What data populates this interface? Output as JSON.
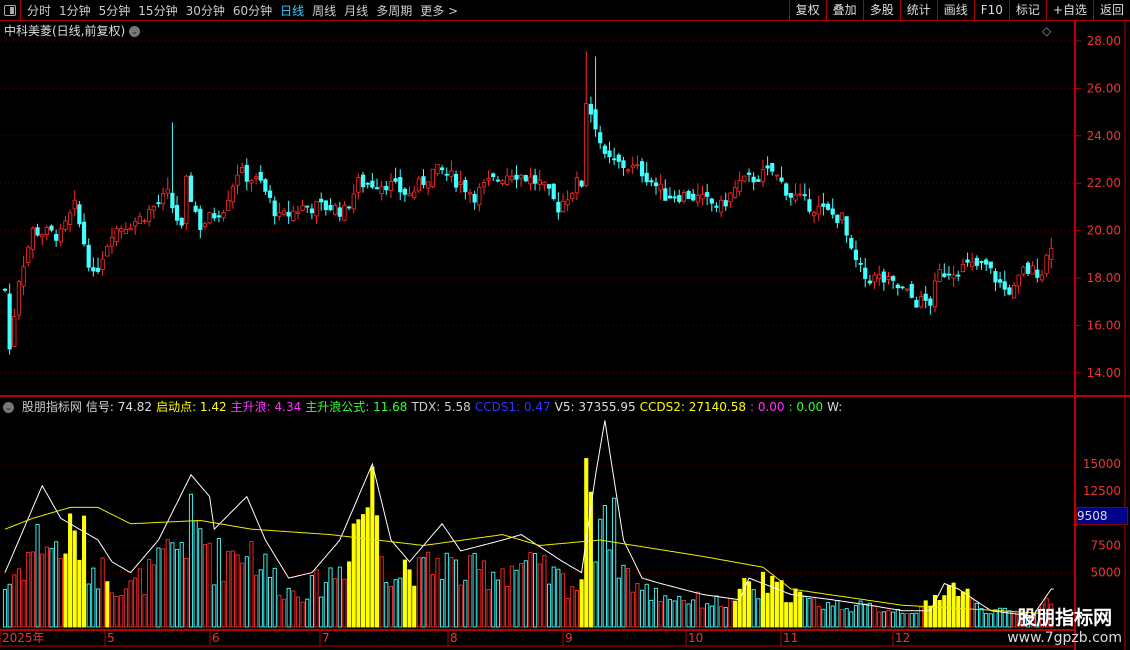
{
  "toolbar": {
    "tabs": [
      "分时",
      "1分钟",
      "5分钟",
      "15分钟",
      "30分钟",
      "60分钟",
      "日线",
      "周线",
      "月线",
      "多周期",
      "更多 >"
    ],
    "active": "日线",
    "right_buttons": [
      "复权",
      "叠加",
      "多股",
      "统计",
      "画线",
      "F10",
      "标记",
      "+自选",
      "返回"
    ]
  },
  "stock_title": "中科美菱(日线,前复权)",
  "indicator": {
    "name": "股朋指标网",
    "items": [
      {
        "label": "信号: 74.82",
        "color": "#dddddd"
      },
      {
        "label": "启动点: 1.42",
        "color": "#ffff00"
      },
      {
        "label": "主升浪: 4.34",
        "color": "#ff33ff"
      },
      {
        "label": "主升浪公式: 11.68",
        "color": "#33ff33"
      },
      {
        "label": "TDX: 5.58",
        "color": "#cccccc"
      },
      {
        "label": "CCDS1: 0.47",
        "color": "#3333ff"
      },
      {
        "label": "V5: 37355.95",
        "color": "#dddddd"
      },
      {
        "label": "CCDS2: 27140.58",
        "color": "#ffff00"
      },
      {
        "label": ": 0.00",
        "color": "#ff33ff"
      },
      {
        "label": ": 0.00",
        "color": "#33ff33"
      },
      {
        "label": "W:",
        "color": "#dddddd"
      }
    ]
  },
  "price_axis": [
    "28.00",
    "26.00",
    "24.00",
    "22.00",
    "20.00",
    "18.00",
    "16.00",
    "14.00"
  ],
  "vol_axis": [
    "15000",
    "12500",
    "7500",
    "5000"
  ],
  "vol_marker": "9508",
  "months": [
    "2025年",
    "5",
    "6",
    "7",
    "8",
    "9",
    "10",
    "11",
    "12"
  ],
  "watermark": {
    "name": "股朋指标网",
    "url": "www.7gpzb.com"
  },
  "chart_data": {
    "type": "candlestick",
    "ylim": [
      14,
      28
    ],
    "price_path": [
      [
        0,
        17.5
      ],
      [
        1,
        15
      ],
      [
        3,
        18
      ],
      [
        6,
        20
      ],
      [
        12,
        19.8
      ],
      [
        15,
        21
      ],
      [
        19,
        18
      ],
      [
        23,
        20
      ],
      [
        29,
        20.5
      ],
      [
        35,
        21.5
      ],
      [
        38,
        20
      ],
      [
        39,
        22
      ],
      [
        42,
        20.2
      ],
      [
        47,
        21
      ],
      [
        50,
        22.5
      ],
      [
        55,
        22
      ],
      [
        59,
        20.5
      ],
      [
        64,
        21
      ],
      [
        70,
        21
      ],
      [
        73,
        20.8
      ],
      [
        76,
        22
      ],
      [
        82,
        22
      ],
      [
        87,
        21.5
      ],
      [
        92,
        22.5
      ],
      [
        94,
        22.5
      ],
      [
        98,
        22
      ],
      [
        101,
        21.5
      ],
      [
        104,
        22
      ],
      [
        109,
        22.5
      ],
      [
        115,
        22
      ],
      [
        119,
        21
      ],
      [
        123,
        22
      ],
      [
        124,
        22
      ],
      [
        125,
        25.5
      ],
      [
        127,
        24.5
      ],
      [
        129,
        23
      ],
      [
        137,
        22.5
      ],
      [
        142,
        21.5
      ],
      [
        147,
        21.5
      ],
      [
        154,
        21
      ],
      [
        158,
        22
      ],
      [
        165,
        22.5
      ],
      [
        169,
        21.5
      ],
      [
        174,
        21
      ],
      [
        180,
        20.5
      ],
      [
        182,
        19
      ],
      [
        185,
        18
      ],
      [
        188,
        18
      ],
      [
        193,
        17.5
      ],
      [
        196,
        17
      ],
      [
        199,
        17
      ],
      [
        201,
        18.2
      ],
      [
        207,
        18.5
      ],
      [
        211,
        18.5
      ],
      [
        215,
        17.5
      ],
      [
        217,
        17.5
      ],
      [
        219,
        18.3
      ],
      [
        223,
        18.3
      ],
      [
        225,
        19.5
      ]
    ],
    "white_line": [
      [
        0,
        5000
      ],
      [
        8,
        13000
      ],
      [
        12,
        10000
      ],
      [
        20,
        8000
      ],
      [
        23,
        6000
      ],
      [
        27,
        5000
      ],
      [
        33,
        8000
      ],
      [
        40,
        14000
      ],
      [
        44,
        12000
      ],
      [
        45,
        9000
      ],
      [
        52,
        12000
      ],
      [
        56,
        8000
      ],
      [
        61,
        4500
      ],
      [
        66,
        5000
      ],
      [
        72,
        8000
      ],
      [
        79,
        15000
      ],
      [
        83,
        8000
      ],
      [
        87,
        6000
      ],
      [
        94,
        9500
      ],
      [
        98,
        7000
      ],
      [
        107,
        8000
      ],
      [
        111,
        8500
      ],
      [
        120,
        6000
      ],
      [
        124,
        5000
      ],
      [
        127,
        14000
      ],
      [
        129,
        19000
      ],
      [
        133,
        8000
      ],
      [
        137,
        4500
      ],
      [
        141,
        4000
      ],
      [
        150,
        3000
      ],
      [
        158,
        2500
      ],
      [
        160,
        4500
      ],
      [
        169,
        3000
      ],
      [
        178,
        2500
      ],
      [
        186,
        2000
      ],
      [
        193,
        1500
      ],
      [
        199,
        1500
      ],
      [
        202,
        4000
      ],
      [
        205,
        3500
      ],
      [
        212,
        1500
      ],
      [
        221,
        1000
      ],
      [
        225,
        3500
      ]
    ],
    "yellow_line": [
      [
        0,
        9000
      ],
      [
        6,
        10000
      ],
      [
        14,
        11000
      ],
      [
        20,
        11000
      ],
      [
        27,
        9500
      ],
      [
        42,
        9800
      ],
      [
        53,
        9000
      ],
      [
        70,
        8500
      ],
      [
        90,
        7500
      ],
      [
        107,
        8500
      ],
      [
        115,
        7500
      ],
      [
        128,
        8000
      ],
      [
        150,
        6500
      ],
      [
        163,
        5500
      ],
      [
        169,
        3500
      ],
      [
        193,
        2000
      ],
      [
        214,
        1500
      ],
      [
        225,
        1200
      ]
    ],
    "signal_ranges": [
      [
        13,
        17
      ],
      [
        22,
        22
      ],
      [
        74,
        80
      ],
      [
        86,
        88
      ],
      [
        124,
        126
      ],
      [
        157,
        160
      ],
      [
        163,
        171
      ],
      [
        198,
        207
      ]
    ],
    "vol_ylim": [
      0,
      17000
    ]
  }
}
